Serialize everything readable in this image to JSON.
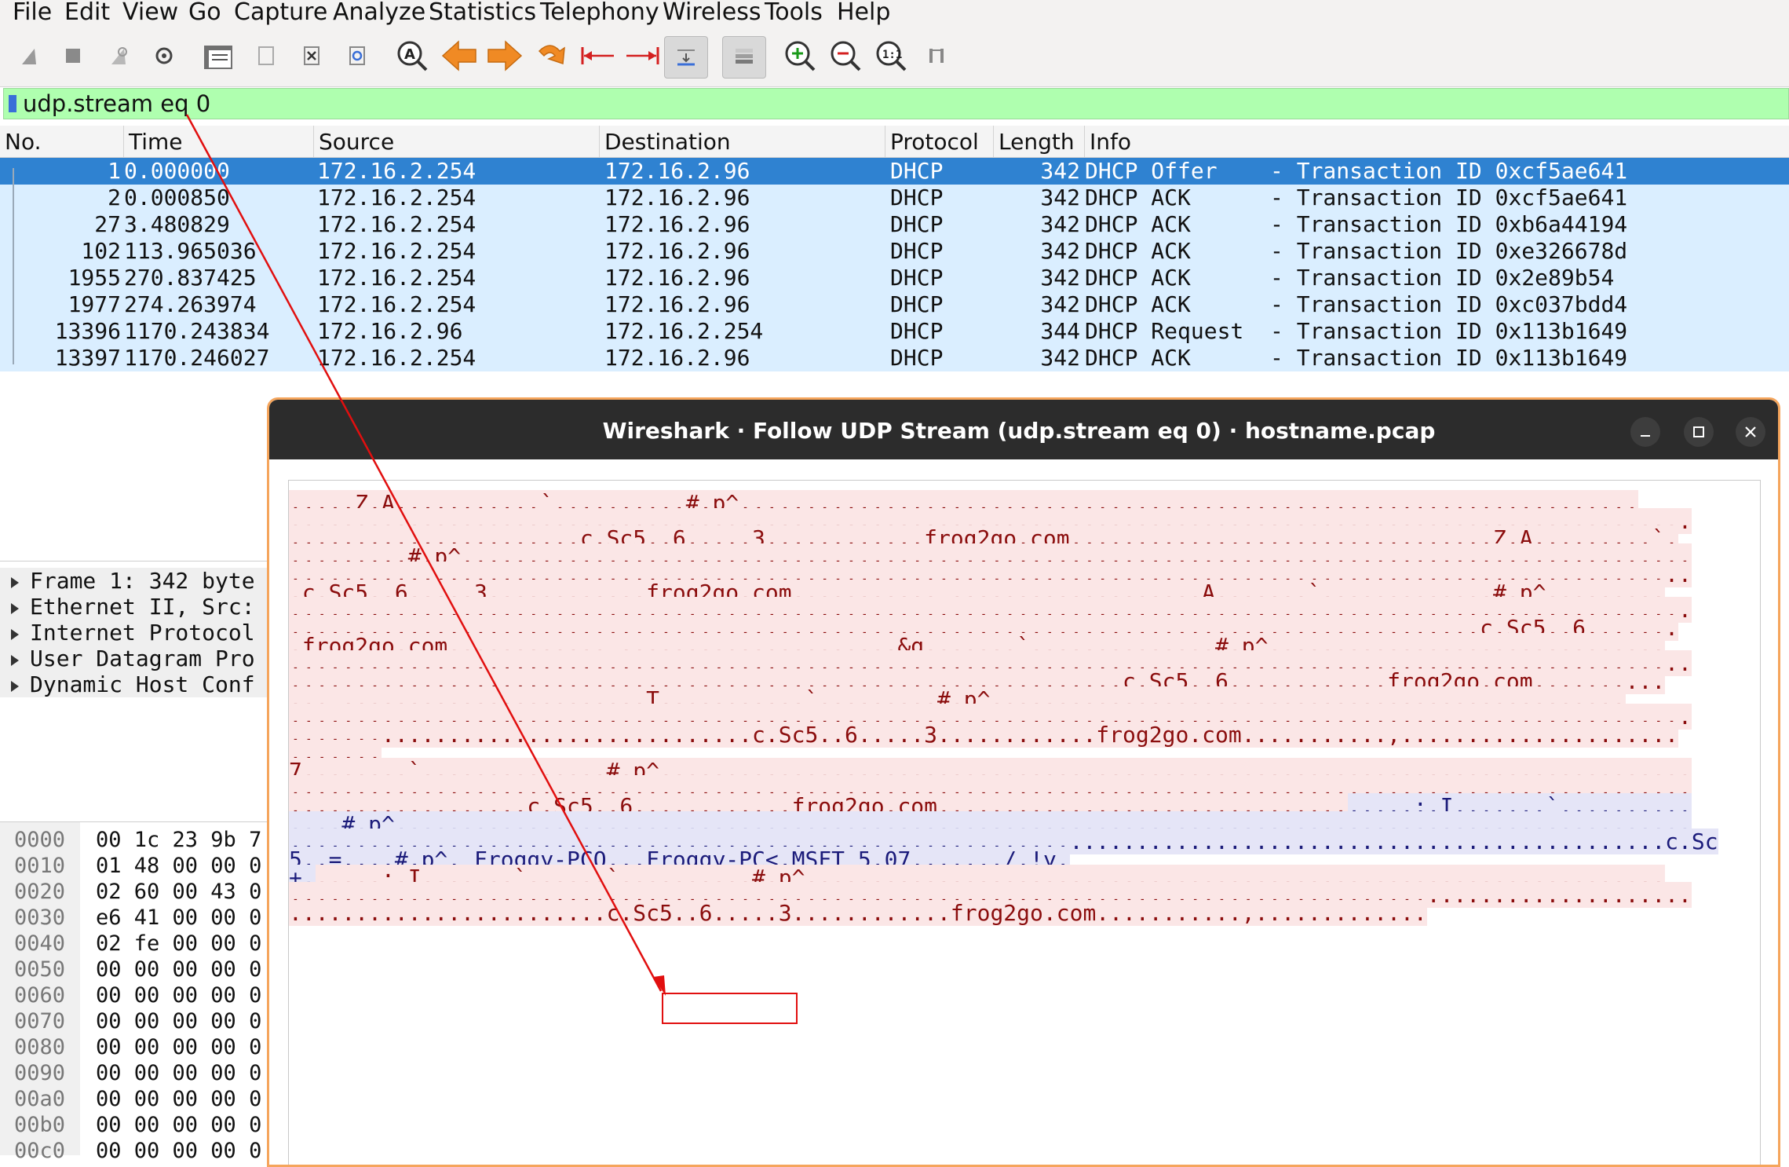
{
  "menu": [
    "File",
    "Edit",
    "View",
    "Go",
    "Capture",
    "Analyze",
    "Statistics",
    "Telephony",
    "Wireless",
    "Tools",
    "Help"
  ],
  "toolbar_icons": [
    "shark-fin-start-icon",
    "stop-square-icon",
    "shark-fin-restart-icon",
    "gear-options-icon",
    "open-folder-icon",
    "file-icon",
    "close-file-x-icon",
    "reload-icon",
    "find-magnifier-icon",
    "arrow-left-back-icon",
    "arrow-right-forward-icon",
    "jump-curved-arrow-icon",
    "go-first-icon",
    "go-last-icon",
    "autoscroll-icon",
    "colorize-lines-icon",
    "zoom-in-icon",
    "zoom-out-icon",
    "zoom-normal-icon",
    "resize-columns-icon"
  ],
  "filter": {
    "value": "udp.stream eq 0"
  },
  "columns": [
    "No.",
    "Time",
    "Source",
    "Destination",
    "Protocol",
    "Length",
    "Info"
  ],
  "packets": [
    {
      "no": "1",
      "time": "0.000000",
      "src": "172.16.2.254",
      "dst": "172.16.2.96",
      "proto": "DHCP",
      "len": "342",
      "info": "DHCP Offer    - Transaction ID 0xcf5ae641"
    },
    {
      "no": "2",
      "time": "0.000850",
      "src": "172.16.2.254",
      "dst": "172.16.2.96",
      "proto": "DHCP",
      "len": "342",
      "info": "DHCP ACK      - Transaction ID 0xcf5ae641"
    },
    {
      "no": "27",
      "time": "3.480829",
      "src": "172.16.2.254",
      "dst": "172.16.2.96",
      "proto": "DHCP",
      "len": "342",
      "info": "DHCP ACK      - Transaction ID 0xb6a44194"
    },
    {
      "no": "102",
      "time": "113.965036",
      "src": "172.16.2.254",
      "dst": "172.16.2.96",
      "proto": "DHCP",
      "len": "342",
      "info": "DHCP ACK      - Transaction ID 0xe326678d"
    },
    {
      "no": "1955",
      "time": "270.837425",
      "src": "172.16.2.254",
      "dst": "172.16.2.96",
      "proto": "DHCP",
      "len": "342",
      "info": "DHCP ACK      - Transaction ID 0x2e89b54"
    },
    {
      "no": "1977",
      "time": "274.263974",
      "src": "172.16.2.254",
      "dst": "172.16.2.96",
      "proto": "DHCP",
      "len": "342",
      "info": "DHCP ACK      - Transaction ID 0xc037bdd4"
    },
    {
      "no": "13396",
      "time": "1170.243834",
      "src": "172.16.2.96",
      "dst": "172.16.2.254",
      "proto": "DHCP",
      "len": "344",
      "info": "DHCP Request  - Transaction ID 0x113b1649"
    },
    {
      "no": "13397",
      "time": "1170.246027",
      "src": "172.16.2.254",
      "dst": "172.16.2.96",
      "proto": "DHCP",
      "len": "342",
      "info": "DHCP ACK      - Transaction ID 0x113b1649"
    }
  ],
  "details": [
    "Frame 1: 342 byte",
    "Ethernet II, Src:",
    "Internet Protocol",
    "User Datagram Pro",
    "Dynamic Host Conf"
  ],
  "hex": [
    {
      "off": "0000",
      "bytes": "00 1c 23 9b 7"
    },
    {
      "off": "0010",
      "bytes": "01 48 00 00 0"
    },
    {
      "off": "0020",
      "bytes": "02 60 00 43 0"
    },
    {
      "off": "0030",
      "bytes": "e6 41 00 00 0"
    },
    {
      "off": "0040",
      "bytes": "02 fe 00 00 0"
    },
    {
      "off": "0050",
      "bytes": "00 00 00 00 0"
    },
    {
      "off": "0060",
      "bytes": "00 00 00 00 0"
    },
    {
      "off": "0070",
      "bytes": "00 00 00 00 0"
    },
    {
      "off": "0080",
      "bytes": "00 00 00 00 0"
    },
    {
      "off": "0090",
      "bytes": "00 00 00 00 0"
    },
    {
      "off": "00a0",
      "bytes": "00 00 00 00 0"
    },
    {
      "off": "00b0",
      "bytes": "00 00 00 00 0"
    },
    {
      "off": "00c0",
      "bytes": "00 00 00 00 0"
    }
  ],
  "dialog": {
    "title": "Wireshark · Follow UDP Stream (udp.stream eq 0) · hostname.pcap",
    "stream_lines": [
      [
        {
          "t": ".....Z.A...........`..........#.p^....................................................................",
          "k": "cl"
        }
      ],
      [
        {
          "t": "..........................................................................................................",
          "k": "cl"
        }
      ],
      [
        {
          "t": "......................c.Sc5..6.....3............frog2go.com............,...................Z.A.........`.",
          "k": "cl"
        }
      ],
      [
        {
          "t": ".........#.p^.............................................................................................",
          "k": "cl"
        }
      ],
      [
        {
          "t": "..........................................................................................................",
          "k": "cl"
        }
      ],
      [
        {
          "t": ".c.Sc5..6.....3............frog2go.com...........,...................A.......`.............#.p^.........",
          "k": "cl"
        }
      ],
      [
        {
          "t": "..........................................................................................................",
          "k": "cl"
        }
      ],
      [
        {
          "t": "..........................................................................................c.Sc5..6.......",
          "k": "cl"
        }
      ],
      [
        {
          "t": ".frog2go.com............,.....................&g.......`..............#.p^..............................",
          "k": "cl"
        }
      ],
      [
        {
          "t": "..........................................................................................................",
          "k": "cl"
        }
      ],
      [
        {
          "t": "...............................................................c.Sc5..6............frog2go.com..........",
          "k": "cl"
        }
      ],
      [
        {
          "t": "...,.......................T...........`.........#.p^................................................",
          "k": "cl"
        }
      ],
      [
        {
          "t": "..........................................................................................................",
          "k": "cl"
        }
      ],
      [
        {
          "t": "...................................c.Sc5..6.....3............frog2go.com...........,.....................",
          "k": "cl"
        }
      ],
      [
        {
          "t": ".......",
          "k": "cl"
        }
      ],
      [
        {
          "t": "7........`..............#.p^..............................................................................",
          "k": "cl"
        }
      ],
      [
        {
          "t": "..........................................................................................................",
          "k": "cl"
        }
      ],
      [
        {
          "t": "..................c.Sc5..6............frog2go.com...........,...................",
          "k": "cl"
        },
        {
          "t": ".....;.I.......`..........",
          "k": "sv"
        }
      ],
      [
        {
          "t": "....#.p^..................................................................................................",
          "k": "sv"
        }
      ],
      [
        {
          "t": "........................................................................................................c.Sc",
          "k": "sv"
        }
      ],
      [
        {
          "t": "5..=....#.p^. Froggy-PCQ...",
          "k": "sv"
        },
        {
          "t": "Froggy-PC",
          "k": "sv"
        },
        {
          "t": "<.MSFT 5.07.....,./.!y.",
          "k": "sv"
        }
      ],
      [
        {
          "t": "+.",
          "k": "sv"
        },
        {
          "t": ".....;.I.......`......`..........#.p^.................................................................",
          "k": "cl"
        }
      ],
      [
        {
          "t": "..........................................................................................................",
          "k": "cl"
        }
      ],
      [
        {
          "t": "........................c.Sc5..6.....3............frog2go.com...........,.............",
          "k": "cl"
        }
      ]
    ]
  },
  "colors": {
    "selected_row": "#2f82d1",
    "row_bg": "#daeeff",
    "filter_bg": "#afffaf",
    "client_text": "#8b0d0d",
    "client_bg": "#fbe6e6",
    "server_text": "#1b1b7a",
    "server_bg": "#e5e5f7",
    "annotation": "#e10f0f"
  }
}
